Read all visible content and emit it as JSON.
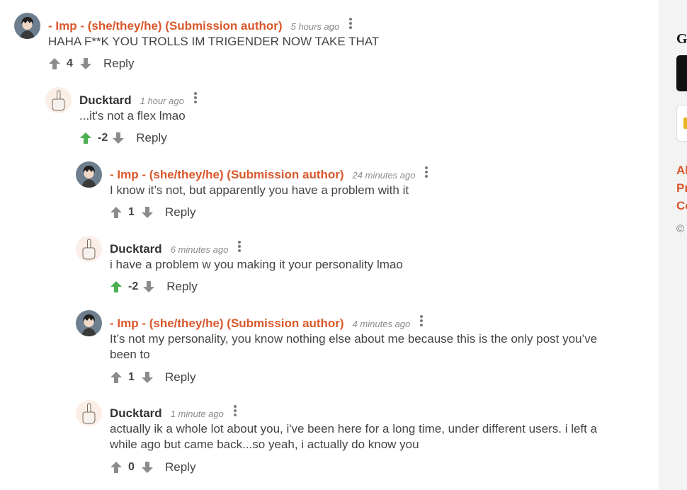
{
  "comments": [
    {
      "author": "- Imp - (she/they/he) (Submission author)",
      "time": "5 hours ago",
      "body": "HAHA F**K YOU TROLLS IM TRIGENDER NOW TAKE THAT",
      "score": "4",
      "reply": "Reply",
      "avatar_icon": "anime-character-avatar",
      "upvoted": false
    },
    {
      "author": "Ducktard",
      "time": "1 hour ago",
      "body": "...it's not a flex lmao",
      "score": "-2",
      "reply": "Reply",
      "avatar_icon": "middle-finger-hand-avatar",
      "upvoted": true
    },
    {
      "author": "- Imp - (she/they/he) (Submission author)",
      "time": "24 minutes ago",
      "body": "I know it’s not, but apparently you have a problem with it",
      "score": "1",
      "reply": "Reply",
      "avatar_icon": "anime-character-avatar",
      "upvoted": false
    },
    {
      "author": "Ducktard",
      "time": "6 minutes ago",
      "body": "i have a problem w you making it your personality lmao",
      "score": "-2",
      "reply": "Reply",
      "avatar_icon": "middle-finger-hand-avatar",
      "upvoted": true
    },
    {
      "author": "- Imp - (she/they/he) (Submission author)",
      "time": "4 minutes ago",
      "body": "It’s not my personality, you know nothing else about me because this is the only post you’ve been to",
      "score": "1",
      "reply": "Reply",
      "avatar_icon": "anime-character-avatar",
      "upvoted": false
    },
    {
      "author": "Ducktard",
      "time": "1 minute ago",
      "body": "actually ik a whole lot about you, i've been here for a long time, under different users. i left a while ago but came back...so yeah, i actually do know you",
      "score": "0",
      "reply": "Reply",
      "avatar_icon": "middle-finger-hand-avatar",
      "upvoted": false
    }
  ],
  "sidebar": {
    "heading": "G",
    "links": [
      "Al",
      "Pr",
      "Co"
    ],
    "copyright": "©"
  },
  "colors": {
    "op_author": "#d9572b",
    "upvote_active": "#4caf50",
    "vote_inactive": "#8c8c8c",
    "sidebar_bg": "#f3f3f3"
  }
}
